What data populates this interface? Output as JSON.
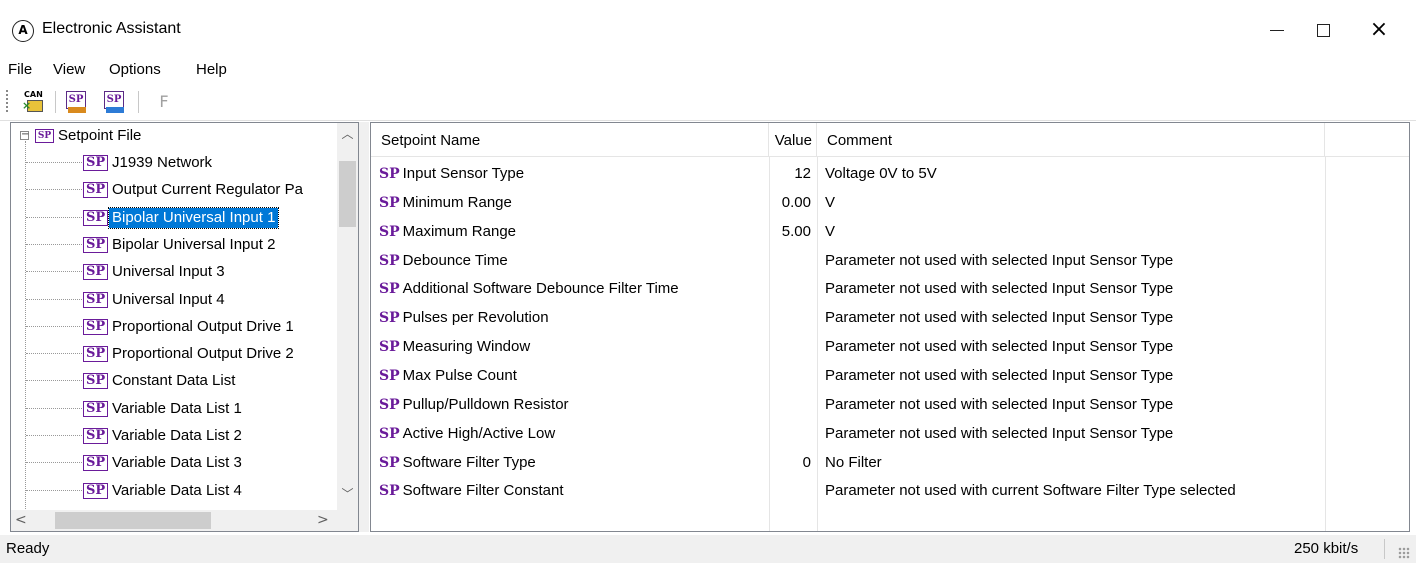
{
  "window": {
    "title": "Electronic Assistant"
  },
  "menu": [
    "File",
    "View",
    "Options",
    "Help"
  ],
  "toolbar": {
    "can_label": "CAN",
    "sp_label": "SP",
    "f_label": "F"
  },
  "tree": {
    "root": "Setpoint File",
    "root_icon": "SP",
    "item_icon": "SP",
    "items": [
      "J1939 Network",
      "Output Current Regulator Pa",
      "Bipolar Universal Input 1",
      "Bipolar Universal Input 2",
      "Universal Input 3",
      "Universal Input 4",
      "Proportional Output Drive 1",
      "Proportional Output Drive 2",
      "Constant Data List",
      "Variable Data List 1",
      "Variable Data List 2",
      "Variable Data List 3",
      "Variable Data List 4"
    ],
    "selected_index": 2
  },
  "grid": {
    "columns": {
      "name": "Setpoint Name",
      "value": "Value",
      "comment": "Comment"
    },
    "row_icon": "SP",
    "rows": [
      {
        "name": "Input Sensor Type",
        "value": "12",
        "comment": "Voltage 0V to 5V"
      },
      {
        "name": "Minimum Range",
        "value": "0.00",
        "comment": "V"
      },
      {
        "name": "Maximum Range",
        "value": "5.00",
        "comment": "V"
      },
      {
        "name": "Debounce Time",
        "value": "",
        "comment": "Parameter not used with selected Input Sensor Type"
      },
      {
        "name": "Additional Software Debounce Filter Time",
        "value": "",
        "comment": "Parameter not used with selected Input Sensor Type"
      },
      {
        "name": "Pulses per Revolution",
        "value": "",
        "comment": "Parameter not used with selected Input Sensor Type"
      },
      {
        "name": "Measuring Window",
        "value": "",
        "comment": "Parameter not used with selected Input Sensor Type"
      },
      {
        "name": "Max Pulse Count",
        "value": "",
        "comment": "Parameter not used with selected Input Sensor Type"
      },
      {
        "name": "Pullup/Pulldown Resistor",
        "value": "",
        "comment": "Parameter not used with selected Input Sensor Type"
      },
      {
        "name": "Active High/Active Low",
        "value": "",
        "comment": "Parameter not used with selected Input Sensor Type"
      },
      {
        "name": "Software Filter Type",
        "value": "0",
        "comment": "No Filter"
      },
      {
        "name": "Software Filter Constant",
        "value": "",
        "comment": "Parameter not used with current Software Filter Type selected"
      }
    ]
  },
  "status": {
    "left": "Ready",
    "right": "250 kbit/s"
  }
}
